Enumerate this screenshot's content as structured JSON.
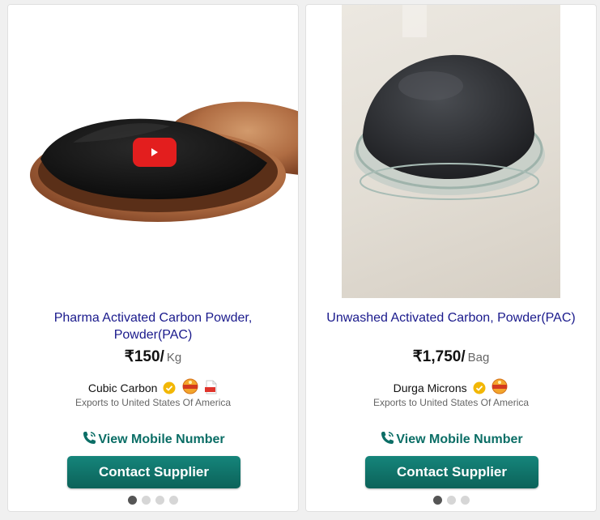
{
  "products": [
    {
      "title": "Pharma Activated Carbon Powder, Powder(PAC)",
      "price": "₹150/",
      "unit": "Kg",
      "supplier": "Cubic Carbon",
      "export_text": "Exports to United States Of America",
      "view_mobile": "View Mobile Number",
      "contact": "Contact Supplier",
      "has_video": true,
      "badges": [
        "verified-icon",
        "trustseal-icon",
        "pdf-icon"
      ],
      "slides": 4,
      "active_slide": 1
    },
    {
      "title": "Unwashed Activated Carbon, Powder(PAC)",
      "price": "₹1,750/",
      "unit": "Bag",
      "supplier": "Durga Microns",
      "export_text": "Exports to United States Of America",
      "view_mobile": "View Mobile Number",
      "contact": "Contact Supplier",
      "has_video": false,
      "badges": [
        "verified-icon",
        "trustseal-icon"
      ],
      "slides": 3,
      "active_slide": 1
    }
  ],
  "colors": {
    "title": "#1a1a8c",
    "accent": "#0b6e66",
    "button": "#0f6f66",
    "video": "#e31e1e",
    "verified": "#f2b705"
  }
}
